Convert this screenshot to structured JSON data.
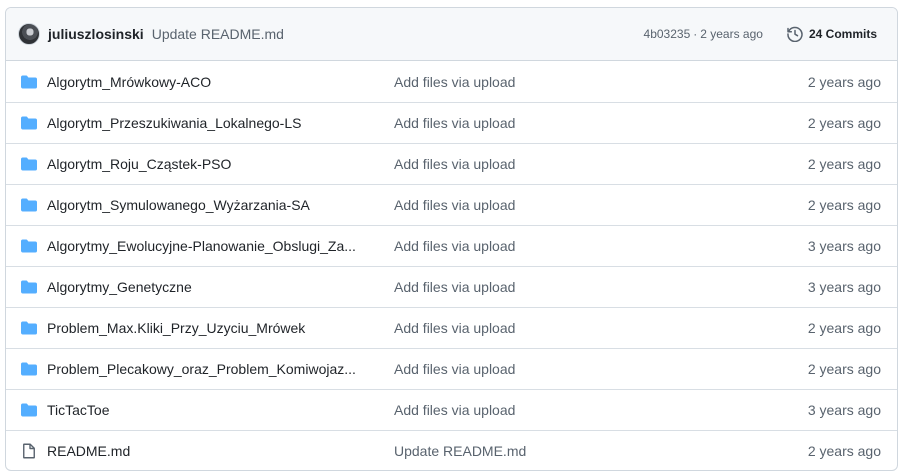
{
  "header": {
    "author": "juliuszlosinski",
    "commit_message": "Update README.md",
    "commit_hash": "4b03235",
    "separator": "·",
    "commit_age": "2 years ago",
    "commits_label": "24 Commits"
  },
  "rows": [
    {
      "type": "folder",
      "name": "Algorytm_Mrówkowy-ACO",
      "message": "Add files via upload",
      "age": "2 years ago"
    },
    {
      "type": "folder",
      "name": "Algorytm_Przeszukiwania_Lokalnego-LS",
      "message": "Add files via upload",
      "age": "2 years ago"
    },
    {
      "type": "folder",
      "name": "Algorytm_Roju_Cząstek-PSO",
      "message": "Add files via upload",
      "age": "2 years ago"
    },
    {
      "type": "folder",
      "name": "Algorytm_Symulowanego_Wyżarzania-SA",
      "message": "Add files via upload",
      "age": "2 years ago"
    },
    {
      "type": "folder",
      "name": "Algorytmy_Ewolucyjne-Planowanie_Obslugi_Za...",
      "message": "Add files via upload",
      "age": "3 years ago"
    },
    {
      "type": "folder",
      "name": "Algorytmy_Genetyczne",
      "message": "Add files via upload",
      "age": "3 years ago"
    },
    {
      "type": "folder",
      "name": "Problem_Max.Kliki_Przy_Uzyciu_Mrówek",
      "message": "Add files via upload",
      "age": "2 years ago"
    },
    {
      "type": "folder",
      "name": "Problem_Plecakowy_oraz_Problem_Komiwojaz...",
      "message": "Add files via upload",
      "age": "2 years ago"
    },
    {
      "type": "folder",
      "name": "TicTacToe",
      "message": "Add files via upload",
      "age": "3 years ago"
    },
    {
      "type": "file",
      "name": "README.md",
      "message": "Update README.md",
      "age": "2 years ago"
    }
  ],
  "icons": {
    "folder": "folder-icon",
    "file": "file-icon",
    "history": "history-icon"
  },
  "colors": {
    "folder": "#54aeff",
    "file_icon": "#59636e",
    "muted_text": "#59636e",
    "header_bg": "#f6f8fa",
    "border": "#d0d7de"
  }
}
